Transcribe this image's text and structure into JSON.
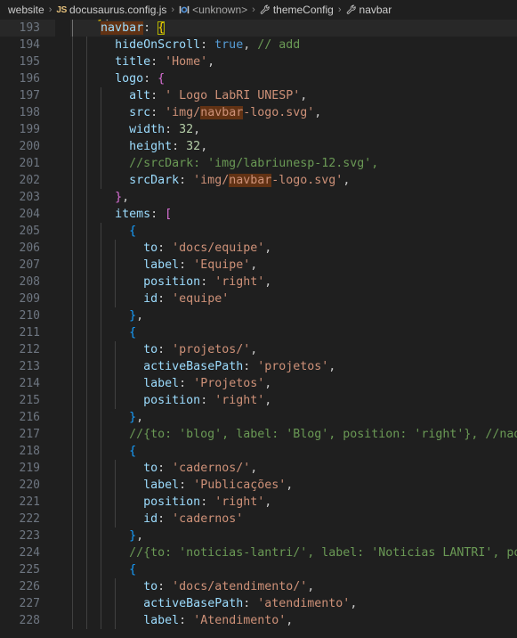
{
  "breadcrumb": {
    "items": [
      {
        "label": "website",
        "icon": "folder-icon",
        "kind": "folder"
      },
      {
        "label": "docusaurus.config.js",
        "icon": "js-file-icon",
        "kind": "file"
      },
      {
        "label": "<unknown>",
        "icon": "symbol-object-icon",
        "kind": "symbol"
      },
      {
        "label": "themeConfig",
        "icon": "wrench-icon",
        "kind": "symbol"
      },
      {
        "label": "navbar",
        "icon": "wrench-icon",
        "kind": "symbol"
      }
    ],
    "separator": "›"
  },
  "editor": {
    "language": "javascript",
    "file_name": "docusaurus.config.js",
    "current_line": 193,
    "find_highlight_term": "navbar",
    "first_visible_line": 192,
    "last_visible_line": 228,
    "partial_top_line_text": "},",
    "colors": {
      "background": "#1f1f1f",
      "current_line_background": "#282828",
      "line_number": "#6e7681",
      "current_line_number": "#c6c6c6",
      "find_match_highlight": "#613214",
      "bracket_match_border": "#b2b200",
      "indent_guide": "#404040",
      "indent_guide_active": "#707070",
      "string": "#ce9178",
      "property": "#9cdcfe",
      "comment": "#6a9955",
      "number": "#b5cea8",
      "keyword": "#569cd6",
      "bracket_level_1": "#ffd700",
      "bracket_level_2": "#da70d6",
      "bracket_level_3": "#179fff"
    },
    "lines": [
      {
        "n": 193,
        "indent": 4,
        "guides": 1,
        "current": true,
        "tokens": [
          {
            "t": "navbar",
            "c": "t-prop",
            "find": true
          },
          {
            "t": ":",
            "c": "t-punct"
          },
          {
            "t": " ",
            "c": "t-plain"
          },
          {
            "t": "{",
            "c": "t-brace1",
            "match": true
          }
        ]
      },
      {
        "n": 194,
        "indent": 6,
        "guides": 2,
        "tokens": [
          {
            "t": "hideOnScroll",
            "c": "t-prop"
          },
          {
            "t": ": ",
            "c": "t-punct"
          },
          {
            "t": "true",
            "c": "t-kw"
          },
          {
            "t": ", ",
            "c": "t-punct"
          },
          {
            "t": "// add",
            "c": "t-comment"
          }
        ]
      },
      {
        "n": 195,
        "indent": 6,
        "guides": 2,
        "tokens": [
          {
            "t": "title",
            "c": "t-prop"
          },
          {
            "t": ": ",
            "c": "t-punct"
          },
          {
            "t": "'Home'",
            "c": "t-string"
          },
          {
            "t": ",",
            "c": "t-punct"
          }
        ]
      },
      {
        "n": 196,
        "indent": 6,
        "guides": 2,
        "tokens": [
          {
            "t": "logo",
            "c": "t-prop"
          },
          {
            "t": ": ",
            "c": "t-punct"
          },
          {
            "t": "{",
            "c": "t-brace2"
          }
        ]
      },
      {
        "n": 197,
        "indent": 8,
        "guides": 3,
        "tokens": [
          {
            "t": "alt",
            "c": "t-prop"
          },
          {
            "t": ": ",
            "c": "t-punct"
          },
          {
            "t": "' Logo LabRI UNESP'",
            "c": "t-string"
          },
          {
            "t": ",",
            "c": "t-punct"
          }
        ]
      },
      {
        "n": 198,
        "indent": 8,
        "guides": 3,
        "tokens": [
          {
            "t": "src",
            "c": "t-prop"
          },
          {
            "t": ": ",
            "c": "t-punct"
          },
          {
            "t": "'img/",
            "c": "t-string"
          },
          {
            "t": "navbar",
            "c": "t-string",
            "find": true
          },
          {
            "t": "-logo.svg'",
            "c": "t-string"
          },
          {
            "t": ",",
            "c": "t-punct"
          }
        ]
      },
      {
        "n": 199,
        "indent": 8,
        "guides": 3,
        "tokens": [
          {
            "t": "width",
            "c": "t-prop"
          },
          {
            "t": ": ",
            "c": "t-punct"
          },
          {
            "t": "32",
            "c": "t-num"
          },
          {
            "t": ",",
            "c": "t-punct"
          }
        ]
      },
      {
        "n": 200,
        "indent": 8,
        "guides": 3,
        "tokens": [
          {
            "t": "height",
            "c": "t-prop"
          },
          {
            "t": ": ",
            "c": "t-punct"
          },
          {
            "t": "32",
            "c": "t-num"
          },
          {
            "t": ",",
            "c": "t-punct"
          }
        ]
      },
      {
        "n": 201,
        "indent": 8,
        "guides": 3,
        "tokens": [
          {
            "t": "//srcDark: 'img/labriunesp-12.svg',",
            "c": "t-comment"
          }
        ]
      },
      {
        "n": 202,
        "indent": 8,
        "guides": 3,
        "tokens": [
          {
            "t": "srcDark",
            "c": "t-prop"
          },
          {
            "t": ": ",
            "c": "t-punct"
          },
          {
            "t": "'img/",
            "c": "t-string"
          },
          {
            "t": "navbar",
            "c": "t-string",
            "find": true
          },
          {
            "t": "-logo.svg'",
            "c": "t-string"
          },
          {
            "t": ",",
            "c": "t-punct"
          }
        ]
      },
      {
        "n": 203,
        "indent": 6,
        "guides": 2,
        "tokens": [
          {
            "t": "}",
            "c": "t-brace2"
          },
          {
            "t": ",",
            "c": "t-punct"
          }
        ]
      },
      {
        "n": 204,
        "indent": 6,
        "guides": 2,
        "tokens": [
          {
            "t": "items",
            "c": "t-prop"
          },
          {
            "t": ": ",
            "c": "t-punct"
          },
          {
            "t": "[",
            "c": "t-brace2"
          }
        ]
      },
      {
        "n": 205,
        "indent": 8,
        "guides": 3,
        "tokens": [
          {
            "t": "{",
            "c": "t-brace3"
          }
        ]
      },
      {
        "n": 206,
        "indent": 10,
        "guides": 4,
        "tokens": [
          {
            "t": "to",
            "c": "t-prop"
          },
          {
            "t": ": ",
            "c": "t-punct"
          },
          {
            "t": "'docs/equipe'",
            "c": "t-string"
          },
          {
            "t": ",",
            "c": "t-punct"
          }
        ]
      },
      {
        "n": 207,
        "indent": 10,
        "guides": 4,
        "tokens": [
          {
            "t": "label",
            "c": "t-prop"
          },
          {
            "t": ": ",
            "c": "t-punct"
          },
          {
            "t": "'Equipe'",
            "c": "t-string"
          },
          {
            "t": ",",
            "c": "t-punct"
          }
        ]
      },
      {
        "n": 208,
        "indent": 10,
        "guides": 4,
        "tokens": [
          {
            "t": "position",
            "c": "t-prop"
          },
          {
            "t": ": ",
            "c": "t-punct"
          },
          {
            "t": "'right'",
            "c": "t-string"
          },
          {
            "t": ",",
            "c": "t-punct"
          }
        ]
      },
      {
        "n": 209,
        "indent": 10,
        "guides": 4,
        "tokens": [
          {
            "t": "id",
            "c": "t-prop"
          },
          {
            "t": ": ",
            "c": "t-punct"
          },
          {
            "t": "'equipe'",
            "c": "t-string"
          }
        ]
      },
      {
        "n": 210,
        "indent": 8,
        "guides": 3,
        "tokens": [
          {
            "t": "}",
            "c": "t-brace3"
          },
          {
            "t": ",",
            "c": "t-punct"
          }
        ]
      },
      {
        "n": 211,
        "indent": 8,
        "guides": 3,
        "tokens": [
          {
            "t": "{",
            "c": "t-brace3"
          }
        ]
      },
      {
        "n": 212,
        "indent": 10,
        "guides": 4,
        "tokens": [
          {
            "t": "to",
            "c": "t-prop"
          },
          {
            "t": ": ",
            "c": "t-punct"
          },
          {
            "t": "'projetos/'",
            "c": "t-string"
          },
          {
            "t": ",",
            "c": "t-punct"
          }
        ]
      },
      {
        "n": 213,
        "indent": 10,
        "guides": 4,
        "tokens": [
          {
            "t": "activeBasePath",
            "c": "t-prop"
          },
          {
            "t": ": ",
            "c": "t-punct"
          },
          {
            "t": "'projetos'",
            "c": "t-string"
          },
          {
            "t": ",",
            "c": "t-punct"
          }
        ]
      },
      {
        "n": 214,
        "indent": 10,
        "guides": 4,
        "tokens": [
          {
            "t": "label",
            "c": "t-prop"
          },
          {
            "t": ": ",
            "c": "t-punct"
          },
          {
            "t": "'Projetos'",
            "c": "t-string"
          },
          {
            "t": ",",
            "c": "t-punct"
          }
        ]
      },
      {
        "n": 215,
        "indent": 10,
        "guides": 4,
        "tokens": [
          {
            "t": "position",
            "c": "t-prop"
          },
          {
            "t": ": ",
            "c": "t-punct"
          },
          {
            "t": "'right'",
            "c": "t-string"
          },
          {
            "t": ",",
            "c": "t-punct"
          }
        ]
      },
      {
        "n": 216,
        "indent": 8,
        "guides": 3,
        "tokens": [
          {
            "t": "}",
            "c": "t-brace3"
          },
          {
            "t": ",",
            "c": "t-punct"
          }
        ]
      },
      {
        "n": 217,
        "indent": 8,
        "guides": 3,
        "tokens": [
          {
            "t": "//{to: 'blog', label: 'Blog', position: 'right'}, //nadd",
            "c": "t-comment"
          }
        ]
      },
      {
        "n": 218,
        "indent": 8,
        "guides": 3,
        "tokens": [
          {
            "t": "{",
            "c": "t-brace3"
          }
        ]
      },
      {
        "n": 219,
        "indent": 10,
        "guides": 4,
        "tokens": [
          {
            "t": "to",
            "c": "t-prop"
          },
          {
            "t": ": ",
            "c": "t-punct"
          },
          {
            "t": "'cadernos/'",
            "c": "t-string"
          },
          {
            "t": ",",
            "c": "t-punct"
          }
        ]
      },
      {
        "n": 220,
        "indent": 10,
        "guides": 4,
        "tokens": [
          {
            "t": "label",
            "c": "t-prop"
          },
          {
            "t": ": ",
            "c": "t-punct"
          },
          {
            "t": "'Publicações'",
            "c": "t-string"
          },
          {
            "t": ",",
            "c": "t-punct"
          }
        ]
      },
      {
        "n": 221,
        "indent": 10,
        "guides": 4,
        "tokens": [
          {
            "t": "position",
            "c": "t-prop"
          },
          {
            "t": ": ",
            "c": "t-punct"
          },
          {
            "t": "'right'",
            "c": "t-string"
          },
          {
            "t": ",",
            "c": "t-punct"
          }
        ]
      },
      {
        "n": 222,
        "indent": 10,
        "guides": 4,
        "tokens": [
          {
            "t": "id",
            "c": "t-prop"
          },
          {
            "t": ": ",
            "c": "t-punct"
          },
          {
            "t": "'cadernos'",
            "c": "t-string"
          }
        ]
      },
      {
        "n": 223,
        "indent": 8,
        "guides": 3,
        "tokens": [
          {
            "t": "}",
            "c": "t-brace3"
          },
          {
            "t": ",",
            "c": "t-punct"
          }
        ]
      },
      {
        "n": 224,
        "indent": 8,
        "guides": 3,
        "tokens": [
          {
            "t": "//{to: 'noticias-lantri/', label: 'Noticias LANTRI', positi",
            "c": "t-comment"
          }
        ]
      },
      {
        "n": 225,
        "indent": 8,
        "guides": 3,
        "tokens": [
          {
            "t": "{",
            "c": "t-brace3"
          }
        ]
      },
      {
        "n": 226,
        "indent": 10,
        "guides": 4,
        "tokens": [
          {
            "t": "to",
            "c": "t-prop"
          },
          {
            "t": ": ",
            "c": "t-punct"
          },
          {
            "t": "'docs/atendimento/'",
            "c": "t-string"
          },
          {
            "t": ",",
            "c": "t-punct"
          }
        ]
      },
      {
        "n": 227,
        "indent": 10,
        "guides": 4,
        "tokens": [
          {
            "t": "activeBasePath",
            "c": "t-prop"
          },
          {
            "t": ": ",
            "c": "t-punct"
          },
          {
            "t": "'atendimento'",
            "c": "t-string"
          },
          {
            "t": ",",
            "c": "t-punct"
          }
        ]
      },
      {
        "n": 228,
        "indent": 10,
        "guides": 4,
        "tokens": [
          {
            "t": "label",
            "c": "t-prop"
          },
          {
            "t": ": ",
            "c": "t-punct"
          },
          {
            "t": "'Atendimento'",
            "c": "t-string"
          },
          {
            "t": ",",
            "c": "t-punct"
          }
        ]
      }
    ]
  }
}
